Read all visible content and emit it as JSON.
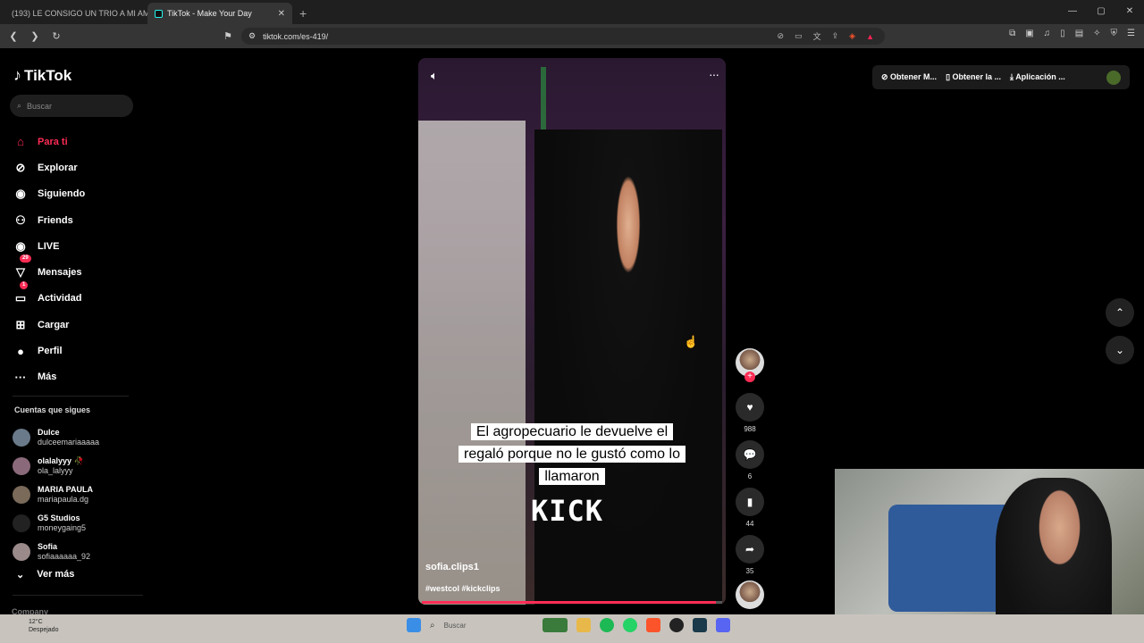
{
  "browser": {
    "tabs": [
      {
        "title": "(193) LE CONSIGO UN TRIO A MI AM",
        "active": false,
        "color": "#ff0033"
      },
      {
        "title": "TikTok - Make Your Day",
        "active": true,
        "color": "#25f4ee"
      }
    ],
    "new_tab": "+",
    "window_controls": [
      "—",
      "▢",
      "✕"
    ],
    "url": "tiktok.com/es-419/"
  },
  "tiktok": {
    "logo": "TikTok",
    "search_placeholder": "Buscar",
    "menu": [
      {
        "label": "Para ti",
        "icon": "home-icon",
        "glyph": "⌂",
        "active": true
      },
      {
        "label": "Explorar",
        "icon": "compass-icon",
        "glyph": "⊘"
      },
      {
        "label": "Siguiendo",
        "icon": "following-avatar-icon",
        "glyph": "◉"
      },
      {
        "label": "Friends",
        "icon": "friends-icon",
        "glyph": "⚇"
      },
      {
        "label": "LIVE",
        "icon": "live-icon",
        "glyph": "◉"
      },
      {
        "label": "Mensajes",
        "icon": "messages-icon",
        "glyph": "▽",
        "badge": "29"
      },
      {
        "label": "Actividad",
        "icon": "activity-icon",
        "glyph": "▭",
        "badge": "1"
      },
      {
        "label": "Cargar",
        "icon": "upload-icon",
        "glyph": "⊞"
      },
      {
        "label": "Perfil",
        "icon": "profile-avatar-icon",
        "glyph": "●"
      },
      {
        "label": "Más",
        "icon": "more-icon",
        "glyph": "···"
      }
    ],
    "following_title": "Cuentas que sigues",
    "following": [
      {
        "name": "Dulce",
        "user": "dulceemariaaaaa",
        "color": "#6a7a8a"
      },
      {
        "name": "olalalyyy 🥀",
        "user": "ola_lalyyy",
        "color": "#8a6a7a"
      },
      {
        "name": "MARIA PAULA",
        "user": "mariapaula.dg",
        "color": "#7a6a5a"
      },
      {
        "name": "G5 Studios",
        "user": "moneygaing5",
        "color": "#222222"
      },
      {
        "name": "Sofia",
        "user": "sofiaaaaaa_92",
        "color": "#9a8a8a"
      }
    ],
    "ver_mas": "Ver más",
    "company": "Company",
    "video": {
      "caption_lines": [
        "El agropecuario le devuelve el",
        "regaló porque no le gustó como lo",
        "llamaron"
      ],
      "overlay_word": "KICK",
      "author": "sofia.clips1",
      "tags": "#westcol #kickclips",
      "progress": 0.98
    },
    "actions": [
      {
        "name": "like",
        "glyph": "♥",
        "count": "988"
      },
      {
        "name": "comment",
        "glyph": "💬",
        "count": "6"
      },
      {
        "name": "save",
        "glyph": "▮",
        "count": "44"
      },
      {
        "name": "share",
        "glyph": "➦",
        "count": "35"
      }
    ],
    "top_buttons": [
      "Obtener M...",
      "Obtener la ...",
      "Aplicación ..."
    ]
  },
  "taskbar": {
    "temp": "12°C",
    "weather": "Despejado",
    "search": "Buscar"
  },
  "colors": {
    "accent": "#fe2c55",
    "background": "#000000"
  }
}
